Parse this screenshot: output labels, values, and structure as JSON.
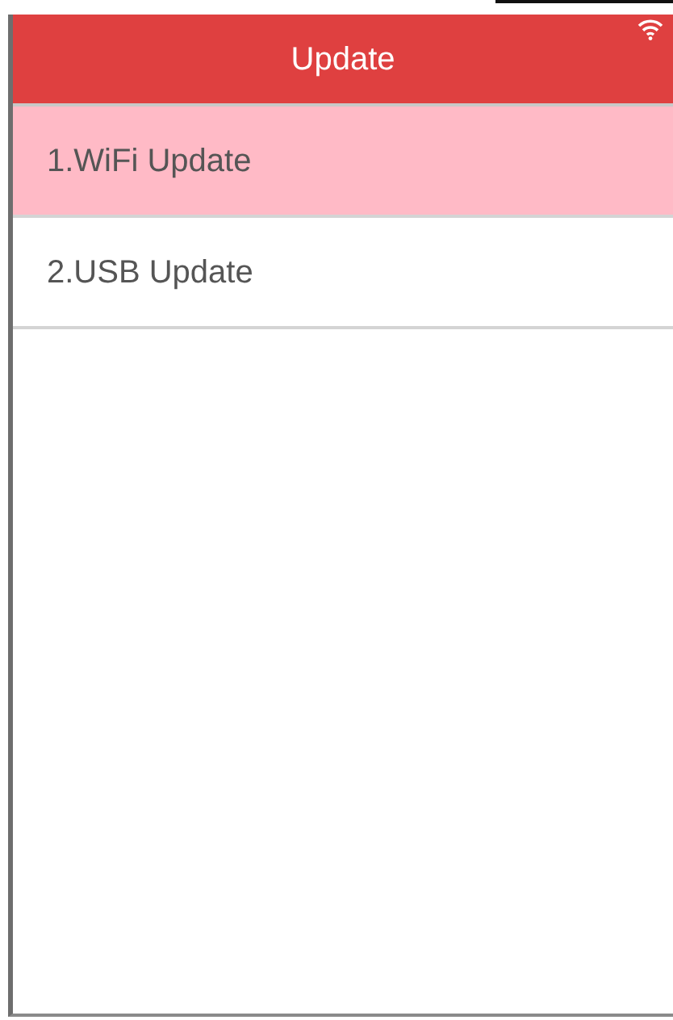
{
  "header": {
    "title": "Update"
  },
  "items": [
    {
      "label": "1.WiFi Update",
      "selected": true
    },
    {
      "label": "2.USB Update",
      "selected": false
    }
  ]
}
